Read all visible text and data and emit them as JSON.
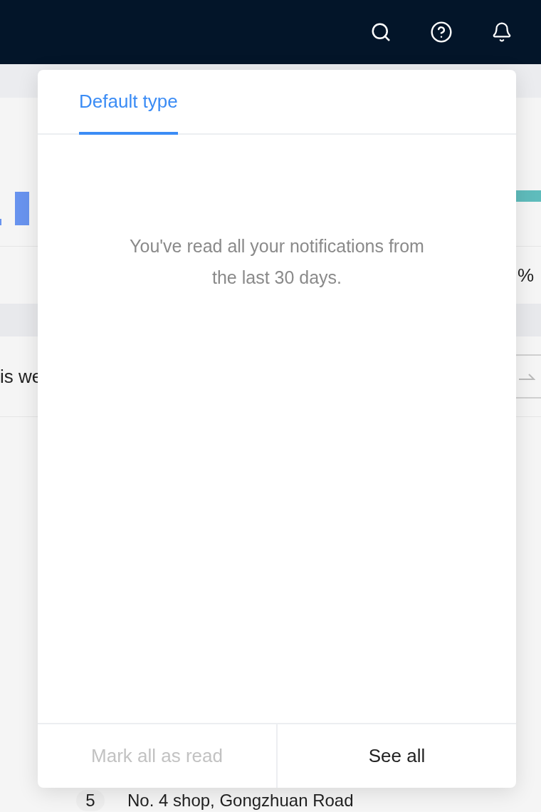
{
  "notifications": {
    "tabs": [
      {
        "label": "Default type",
        "selected": true
      }
    ],
    "empty_message": "You've read all your notifications from the last 30 days.",
    "actions": [
      {
        "label": "Mark all as read",
        "disabled": true
      },
      {
        "label": "See all",
        "disabled": false
      }
    ]
  },
  "background": {
    "percent_text": "%",
    "row_text": "is we",
    "ranking": {
      "rank": "5",
      "name": "No. 4 shop, Gongzhuan Road"
    }
  }
}
